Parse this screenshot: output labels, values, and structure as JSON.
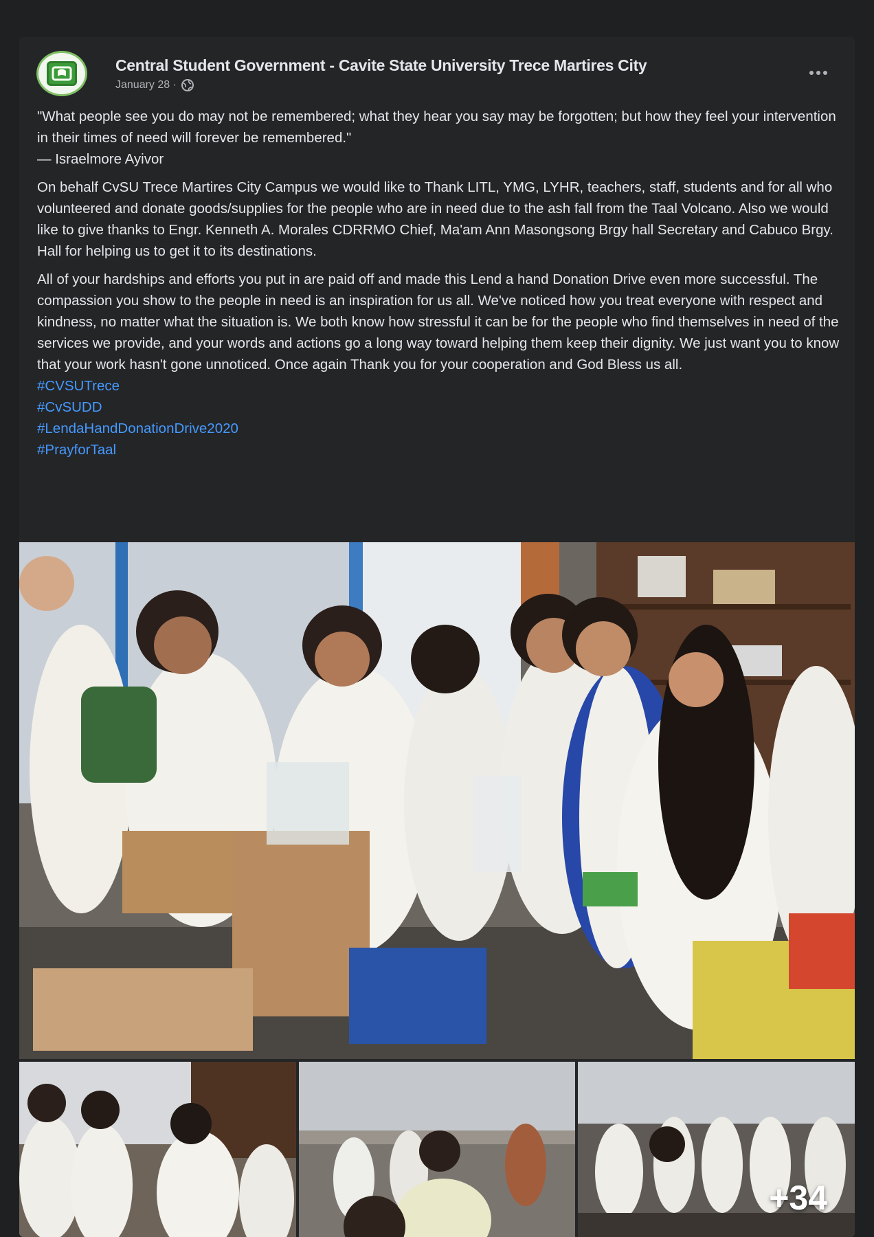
{
  "post": {
    "page_name": "Central Student Government - Cavite State University Trece Martires City",
    "date": "January 28 ·",
    "audience_icon": "globe-icon",
    "more_icon": "more-options-icon",
    "quote": "\"What people see you do may not be remembered; what they hear you say may be forgotten; but how they feel your intervention in their times of need will forever be remembered.\"",
    "quote_author": "— Israelmore Ayivor",
    "paragraph_1": "On behalf CvSU Trece Martires City Campus we would like to Thank LITL, YMG, LYHR, teachers, staff, students and for all who volunteered and donate goods/supplies for the people who are in need due to the ash fall from the Taal Volcano. Also we would like to give thanks to Engr. Kenneth A. Morales CDRRMO Chief, Ma'am Ann Masongsong Brgy hall Secretary and Cabuco Brgy. Hall for helping us to get it to its destinations.",
    "paragraph_2": "All of your hardships and efforts you put in are paid off and made this Lend a hand Donation Drive even more successful. The compassion you show to the people in need is an inspiration for us all. We've noticed how you treat everyone with respect and kindness, no matter what the situation is. We both know how stressful it can be for the people who find themselves in need of the services we provide, and your words and actions go a long way toward helping them keep their dignity. We just want you to know that your work hasn't gone unnoticed. Once again Thank you for your cooperation and God Bless us all.",
    "hashtags": [
      "#CVSUTrece",
      "#CvSUDD",
      "#LendaHandDonationDrive2020",
      "#PrayforTaal"
    ]
  },
  "photos": {
    "more_count": "+34"
  },
  "colors": {
    "background": "#1c1d1f",
    "card": "#242527",
    "text": "#e4e6eb",
    "secondary_text": "#b0b3b8",
    "hashtag": "#4599ff"
  }
}
